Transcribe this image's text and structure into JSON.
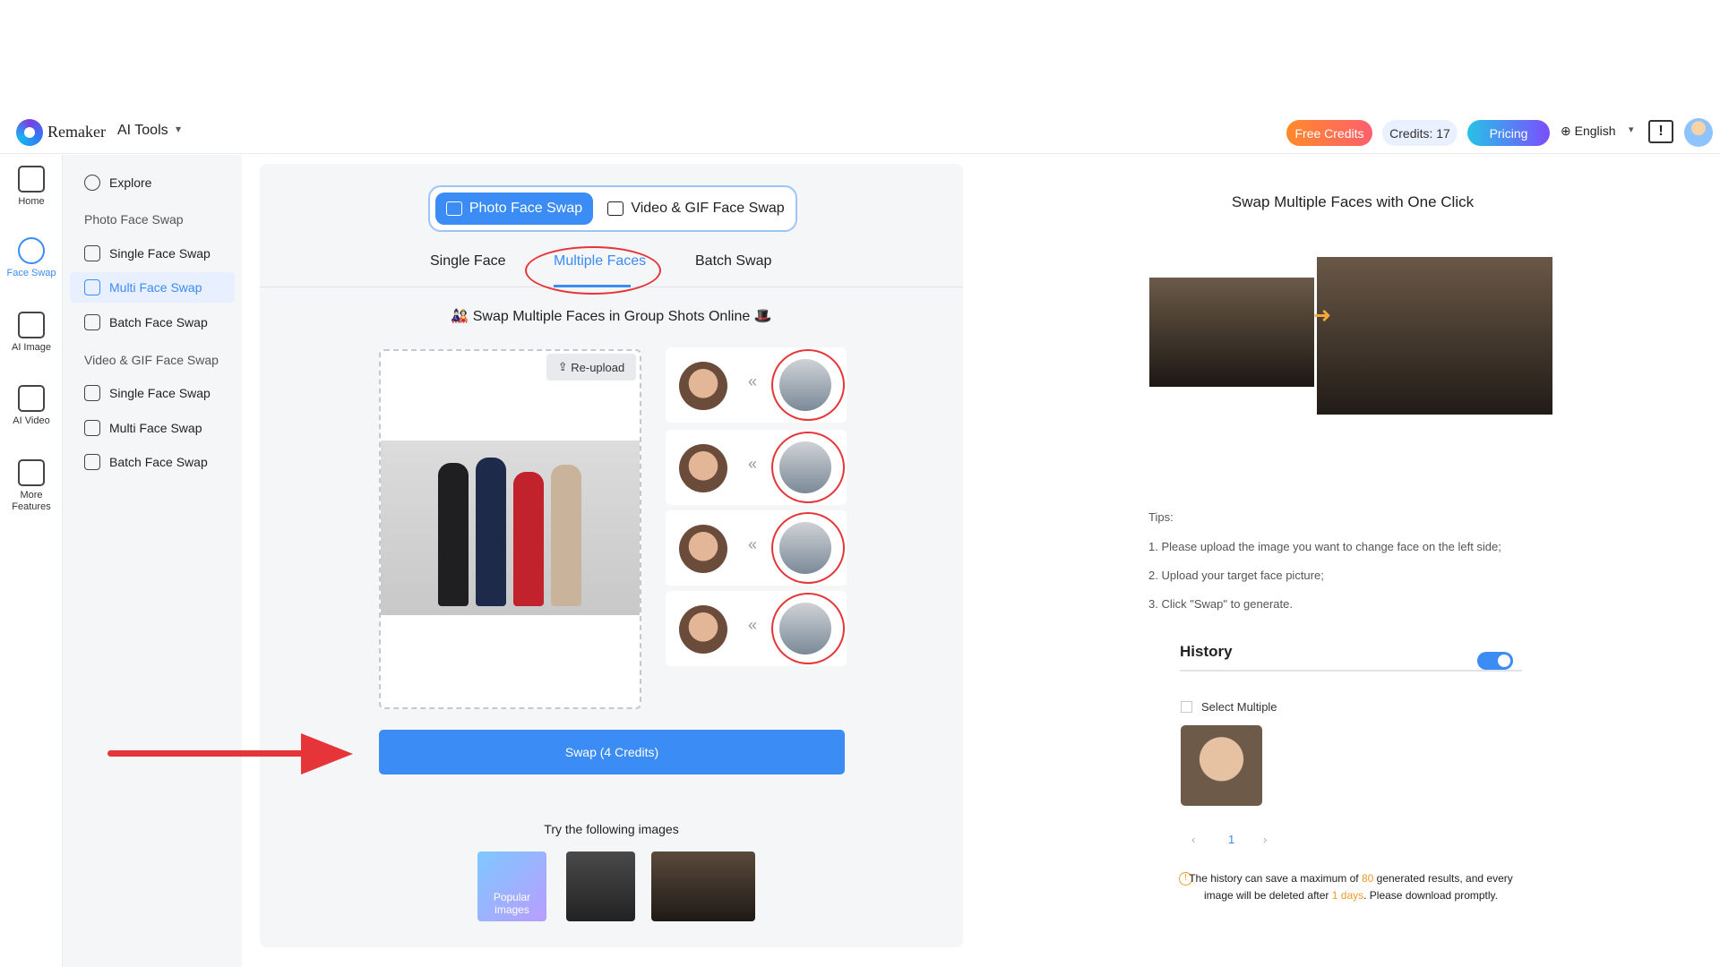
{
  "header": {
    "brand": "Remaker",
    "ai_tools": "AI Tools",
    "free_credits": "Free Credits",
    "credits": "Credits: 17",
    "pricing": "Pricing",
    "language": "English"
  },
  "rail": [
    {
      "label": "Home"
    },
    {
      "label": "Face Swap"
    },
    {
      "label": "AI Image"
    },
    {
      "label": "AI Video"
    },
    {
      "label": "More Features"
    }
  ],
  "nav": {
    "explore": "Explore",
    "photo_head": "Photo Face Swap",
    "photo_items": [
      "Single Face Swap",
      "Multi Face Swap",
      "Batch Face Swap"
    ],
    "video_head": "Video & GIF Face Swap",
    "video_items": [
      "Single Face Swap",
      "Multi Face Swap",
      "Batch Face Swap"
    ]
  },
  "main": {
    "toggle_photo": "Photo Face Swap",
    "toggle_video": "Video & GIF Face Swap",
    "tabs": [
      "Single Face",
      "Multiple Faces",
      "Batch Swap"
    ],
    "headline": "Swap Multiple Faces in Group Shots Online",
    "reupload": "Re-upload",
    "swap_button": "Swap (4 Credits)",
    "try_label": "Try the following images",
    "popular": "Popular images"
  },
  "right": {
    "title": "Swap Multiple Faces with One Click",
    "tips_head": "Tips:",
    "tips": [
      "1. Please upload the image you want to change face on the left side;",
      "2. Upload your target face picture;",
      "3. Click \"Swap\" to generate."
    ],
    "history_title": "History",
    "select_multiple": "Select Multiple",
    "page": "1",
    "notice_a": "The history can save a maximum of ",
    "notice_num": "80",
    "notice_b": " generated results, and every image will be deleted after ",
    "notice_days": "1 days",
    "notice_c": ". Please download promptly."
  },
  "colors": {
    "accent": "#3b8cf5",
    "highlight": "#e63538",
    "warning": "#f09a2e"
  }
}
